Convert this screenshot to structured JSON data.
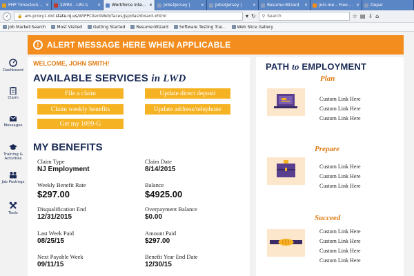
{
  "browser": {
    "tabs": [
      {
        "label": "PHP Timeclock for D...",
        "color": "#e0a020",
        "active": false
      },
      {
        "label": "2WRS - URL's",
        "color": "#c0392b",
        "active": false
      },
      {
        "label": "Workforce Integrated P...",
        "color": "#ffffff",
        "active": true
      },
      {
        "label": "Jobs4Jersey |",
        "color": "#8a9fbf",
        "active": false
      },
      {
        "label": "Jobs4Jersey |",
        "color": "#8a9fbf",
        "active": false
      },
      {
        "label": "Resume:Wizard",
        "color": "#8a9fbf",
        "active": false
      },
      {
        "label": "join.me – Free Scre...",
        "color": "#f28d1e",
        "active": false
      },
      {
        "label": "Depar",
        "color": "#8a9fbf",
        "active": false
      }
    ],
    "url_prefix": "am-proxy1.dol.",
    "url_domain": "state.nj.us",
    "url_path": "/WIPPClientWeb/faces/jsp/dashboard.xhtml",
    "search_placeholder": "Search",
    "bookmarks": [
      "Job Market:Search",
      "Most Visited",
      "Getting Started",
      "Resume:Wizard",
      "Software Testing Trai...",
      "Web Slice Gallery"
    ]
  },
  "alert": {
    "text": "ALERT MESSAGE HERE WHEN APPLICABLE"
  },
  "sidebar": {
    "items": [
      {
        "label": "Dashboard",
        "icon": "dashboard-icon"
      },
      {
        "label": "Claim",
        "icon": "clipboard-icon"
      },
      {
        "label": "Messages",
        "icon": "envelope-icon"
      },
      {
        "label_line1": "Training &",
        "label_line2": "Activities",
        "icon": "graduation-cap-icon"
      },
      {
        "label": "Job Postings",
        "icon": "people-icon"
      },
      {
        "label": "Tools",
        "icon": "tools-icon"
      }
    ]
  },
  "main": {
    "welcome": "WELCOME, JOHN SMITH!",
    "services_title": "AVAILABLE SERVICES",
    "services_title_suffix": "in LWD",
    "services": [
      "File a claim",
      "Update direct deposit",
      "Claim weekly benefits",
      "Update address/telephone",
      "Get my 1099-G"
    ],
    "benefits_title": "MY BENEFITS",
    "benefits": [
      {
        "label": "Claim Type",
        "value": "NJ Employment"
      },
      {
        "label": "Claim Date",
        "value": "8/14/2015"
      },
      {
        "label": "Weekly Benefit Rate",
        "value": "$297.00"
      },
      {
        "label": "Balance",
        "value": "$4925.00"
      },
      {
        "label": "Disqualification End",
        "value": "12/31/2015"
      },
      {
        "label": "Overpayment Balance",
        "value": "$0.00"
      },
      {
        "label": "Last Week Paid",
        "value": "08/25/15"
      },
      {
        "label": "Amount Paid",
        "value": "$297.00"
      },
      {
        "label": "Next Payable Week",
        "value": "09/11/15"
      },
      {
        "label": "Benefit Year End Date",
        "value": "12/30/15"
      }
    ]
  },
  "path": {
    "title": "PATH",
    "title_it": "to",
    "title_end": "EMPLOYMENT",
    "stages": [
      {
        "name": "Plan",
        "links": [
          "Custom Link Here",
          "Custom Link Here",
          "Custom Link Here"
        ]
      },
      {
        "name": "Prepare",
        "links": [
          "Custom Link Here",
          "Custom Link Here",
          "Custom Link Here"
        ]
      },
      {
        "name": "Succeed",
        "links": [
          "Custom Link Here",
          "Custom Link Here",
          "Custom Link Here",
          "Custom Link Here"
        ]
      }
    ]
  },
  "colors": {
    "accent": "#f28d1e",
    "button": "#f5b323",
    "navy": "#1a2a55"
  }
}
